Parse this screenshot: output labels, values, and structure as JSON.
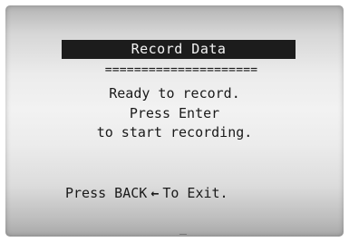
{
  "screen": {
    "title": "Record Data",
    "separator": "=====================",
    "message_line_1": "Ready to record.",
    "message_line_2": "Press Enter",
    "message_line_3": "to start recording.",
    "footer_prefix": "Press BACK",
    "footer_arrow_icon": "left-arrow-icon",
    "footer_suffix": "To Exit."
  }
}
